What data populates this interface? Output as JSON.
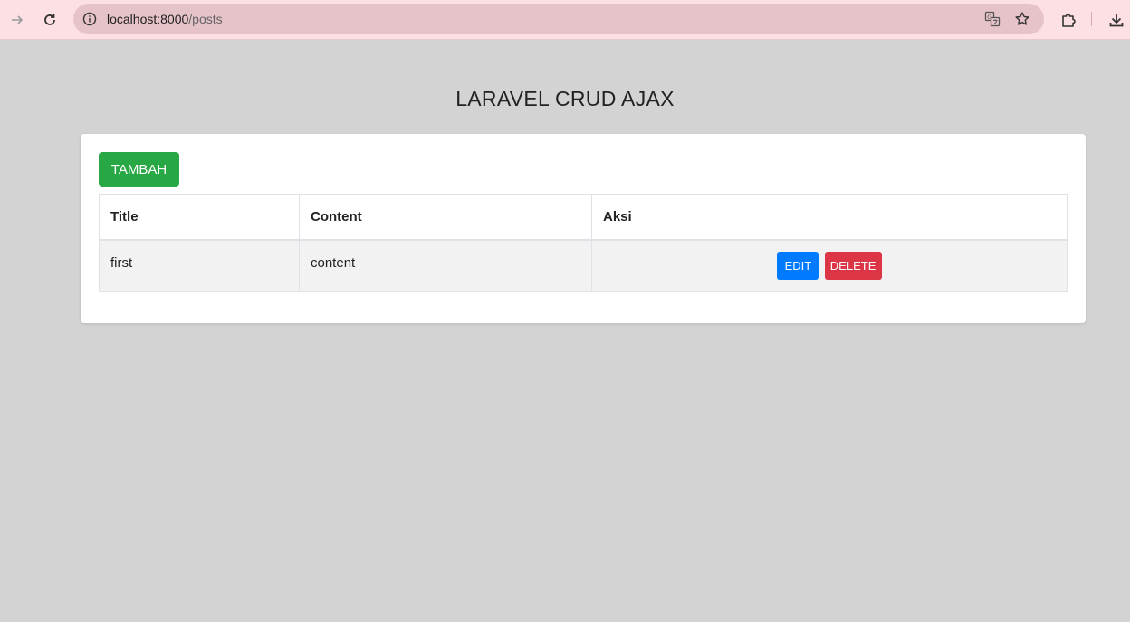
{
  "browser": {
    "url_host": "localhost:8000",
    "url_path": "/posts",
    "icons": {
      "forward": "arrow-right-icon",
      "reload": "reload-icon",
      "site_info": "info-icon",
      "translate": "translate-icon",
      "bookmark": "star-icon",
      "extensions": "puzzle-icon",
      "downloads": "download-icon"
    },
    "toolbar_color": "#fde0e4",
    "omnibox_color": "#e6c3c8"
  },
  "page": {
    "title": "LARAVEL CRUD AJAX",
    "background": "#d3d3d3"
  },
  "actions": {
    "add_label": "TAMBAH",
    "add_color": "#28a745"
  },
  "table": {
    "headers": [
      "Title",
      "Content",
      "Aksi"
    ],
    "rows": [
      {
        "title": "first",
        "content": "content",
        "edit_label": "EDIT",
        "delete_label": "DELETE"
      }
    ],
    "edit_color": "#007bff",
    "delete_color": "#dc3545"
  }
}
